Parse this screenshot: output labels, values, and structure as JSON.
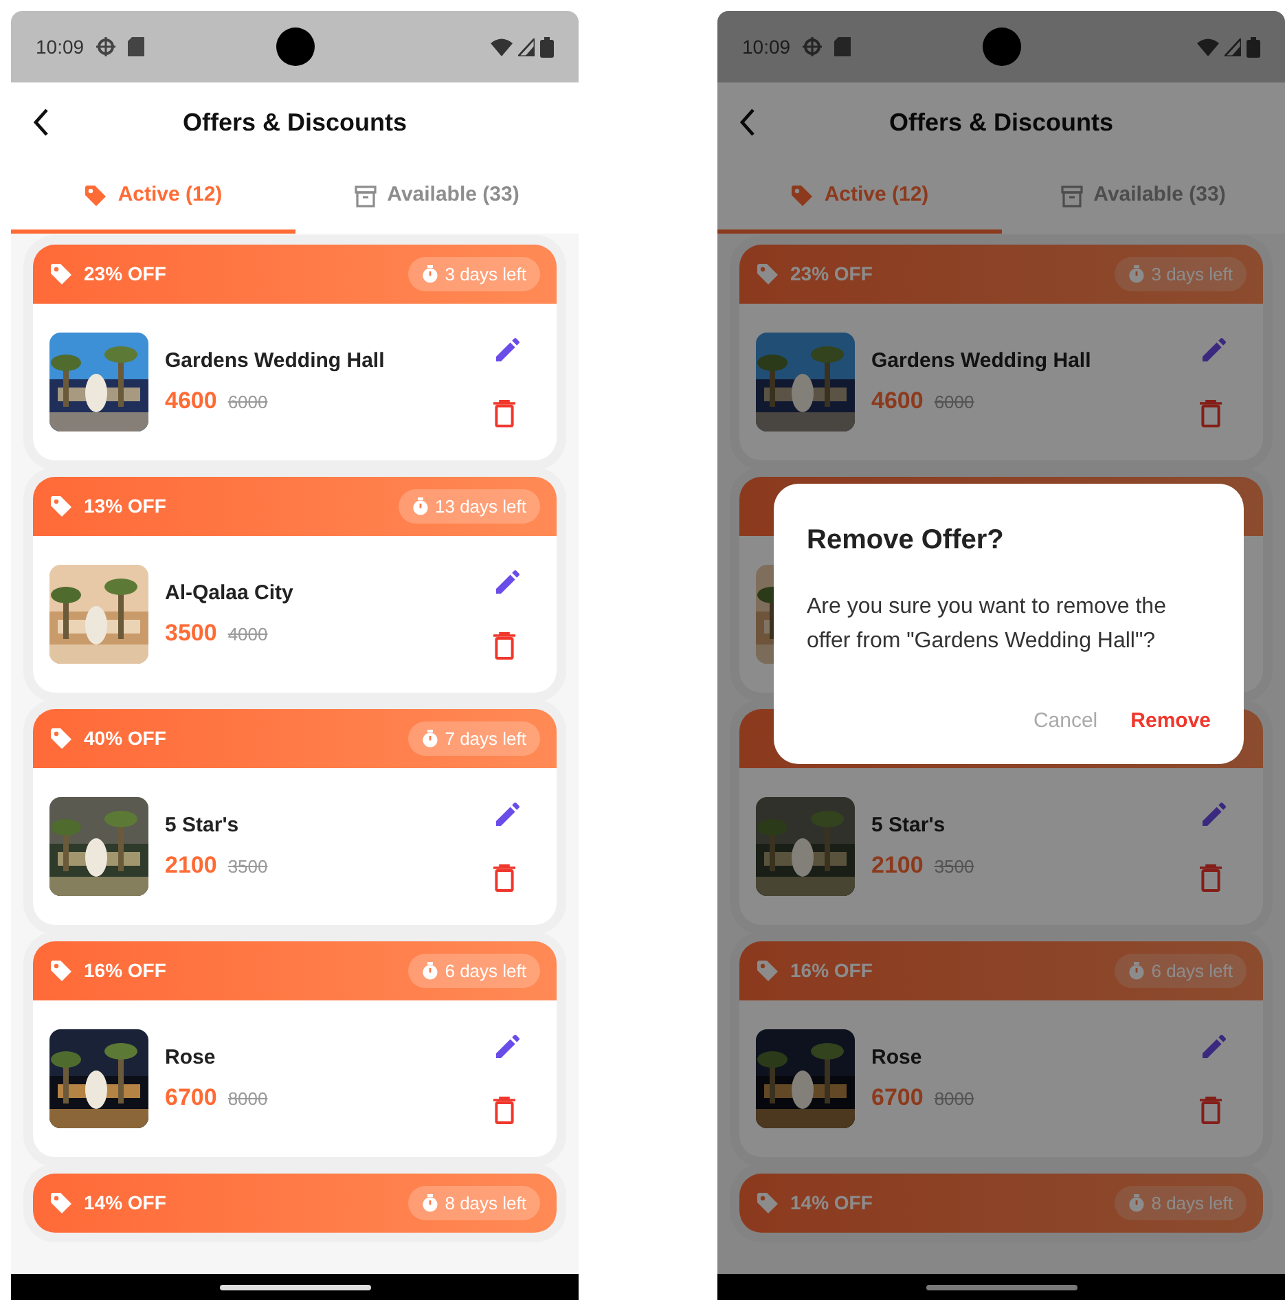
{
  "screens": [
    {
      "status_bar": {
        "time": "10:09"
      },
      "title": "Offers & Discounts",
      "tabs": [
        {
          "label": "Active (12)",
          "selected": true
        },
        {
          "label": "Available (33)",
          "selected": false
        }
      ],
      "offers": [
        {
          "kind": "full",
          "discount": "23% OFF",
          "days_left": "3 days left",
          "name": "Gardens Wedding Hall",
          "price": "4600",
          "old_price": "6000"
        },
        {
          "kind": "full",
          "discount": "13% OFF",
          "days_left": "13 days left",
          "name": "Al-Qalaa City",
          "price": "3500",
          "old_price": "4000"
        },
        {
          "kind": "full",
          "discount": "40% OFF",
          "days_left": "7 days left",
          "name": "5 Star's",
          "price": "2100",
          "old_price": "3500"
        },
        {
          "kind": "full",
          "discount": "16% OFF",
          "days_left": "6 days left",
          "name": "Rose",
          "price": "6700",
          "old_price": "8000"
        },
        {
          "kind": "header",
          "discount": "14% OFF",
          "days_left": "8 days left"
        }
      ]
    },
    {
      "status_bar": {
        "time": "10:09"
      },
      "title": "Offers & Discounts",
      "tabs": [
        {
          "label": "Active (12)",
          "selected": true
        },
        {
          "label": "Available (33)",
          "selected": false
        }
      ],
      "offers": [
        {
          "kind": "full",
          "discount": "23% OFF",
          "days_left": "3 days left",
          "name": "Gardens Wedding Hall",
          "price": "4600",
          "old_price": "6000"
        },
        {
          "kind": "edge"
        },
        {
          "kind": "lower",
          "name": "5 Star's",
          "price": "2100",
          "old_price": "3500"
        },
        {
          "kind": "full",
          "discount": "16% OFF",
          "days_left": "6 days left",
          "name": "Rose",
          "price": "6700",
          "old_price": "8000"
        },
        {
          "kind": "header",
          "discount": "14% OFF",
          "days_left": "8 days left"
        }
      ],
      "dialog": {
        "title": "Remove Offer?",
        "message": "Are you sure you want to remove the offer from \"Gardens Wedding Hall\"?",
        "buttons": [
          {
            "label": "Cancel",
            "kind": "cancel"
          },
          {
            "label": "Remove",
            "kind": "destructive"
          }
        ]
      }
    }
  ]
}
